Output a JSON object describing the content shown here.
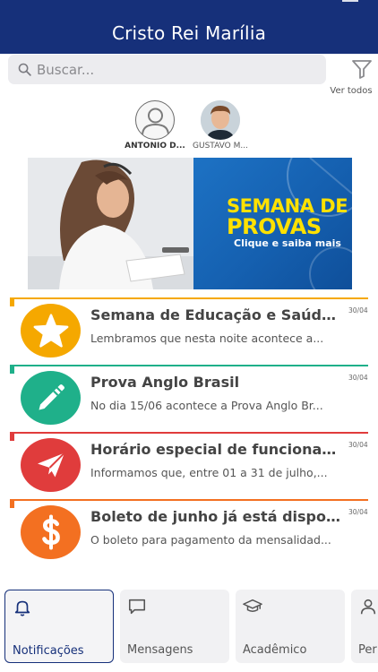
{
  "header": {
    "title": "Cristo Rei Marília"
  },
  "search": {
    "placeholder": "Buscar..."
  },
  "filter": {
    "see_all_label": "Ver todos"
  },
  "contacts": [
    {
      "name": "ANTÔNIO D..."
    },
    {
      "name": "GUSTAVO M..."
    }
  ],
  "banner": {
    "line1": "SEMANA DE",
    "line2": "PROVAS",
    "line3": "Clique e saiba mais"
  },
  "notifications": [
    {
      "title": "Semana de Educação e Saúde...",
      "body": "Lembramos que nesta noite acontece a...",
      "date": "30/04",
      "icon": "star-icon",
      "color": "#f5a800"
    },
    {
      "title": "Prova Anglo Brasil",
      "body": "No dia 15/06 acontece a Prova Anglo Br...",
      "date": "30/04",
      "icon": "pencil-icon",
      "color": "#1fb08a"
    },
    {
      "title": "Horário especial de funcionam...",
      "body": "Informamos que, entre 01 a 31 de julho,...",
      "date": "30/04",
      "icon": "paper-plane-icon",
      "color": "#e03c3c"
    },
    {
      "title": "Boleto de junho já está disponí...",
      "body": "O boleto para pagamento da mensalidad...",
      "date": "30/04",
      "icon": "dollar-icon",
      "color": "#f37021"
    }
  ],
  "tabs": [
    {
      "label": "Notificações",
      "icon": "bell-icon",
      "active": true
    },
    {
      "label": "Mensagens",
      "icon": "chat-icon",
      "active": false
    },
    {
      "label": "Acadêmico",
      "icon": "graduation-cap-icon",
      "active": false
    },
    {
      "label": "Per",
      "icon": "person-icon",
      "active": false
    }
  ],
  "colors": {
    "brand": "#16307a",
    "banner_accent": "#ffe100"
  }
}
